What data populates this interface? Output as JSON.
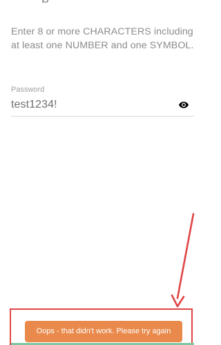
{
  "password_screen": {
    "instructions": "Enter 8 or more CHARACTERS including at least one NUMBER and one SYMBOL.",
    "password_label": "Password",
    "password_value": "test1234!",
    "visibility_icon": "eye-icon"
  },
  "toast": {
    "message": "Oops - that didn't work. Please try again",
    "color": "#e98a4c"
  },
  "annotation": {
    "color": "#e04444"
  },
  "colors": {
    "background": "#ffffff",
    "text": "#8b8b8b",
    "input_text": "#6f6f6f",
    "underline": "#d9d9d9",
    "bottom_bar": "#7cc7a0"
  }
}
